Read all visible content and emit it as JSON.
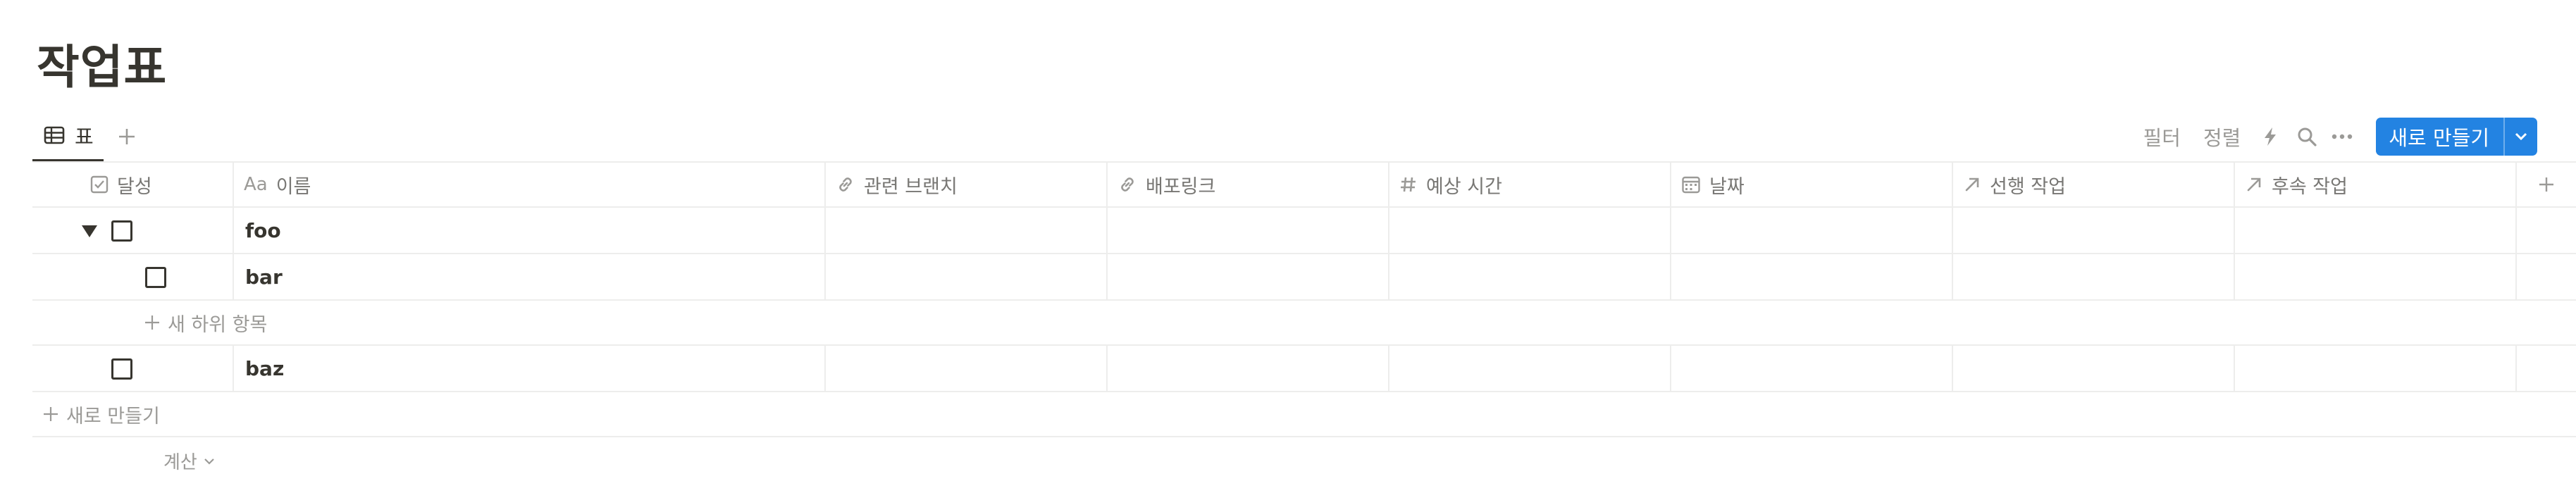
{
  "page": {
    "title": "작업표"
  },
  "view": {
    "tab_label": "표",
    "toolbar": {
      "filter_label": "필터",
      "sort_label": "정렬",
      "new_button_label": "새로 만들기"
    }
  },
  "table": {
    "columns": [
      {
        "label": "달성",
        "icon": "checkbox-icon"
      },
      {
        "label": "이름",
        "icon": "text-aa-icon",
        "icon_text": "Aa"
      },
      {
        "label": "관련 브랜치",
        "icon": "link-icon"
      },
      {
        "label": "배포링크",
        "icon": "link-icon"
      },
      {
        "label": "예상 시간",
        "icon": "hash-icon"
      },
      {
        "label": "날짜",
        "icon": "calendar-icon"
      },
      {
        "label": "선행 작업",
        "icon": "relation-arrow-icon"
      },
      {
        "label": "후속 작업",
        "icon": "relation-arrow-icon"
      }
    ],
    "rows": [
      {
        "name": "foo",
        "done": false,
        "expanded": true
      },
      {
        "name": "bar",
        "done": false,
        "subitem": true
      },
      {
        "name": "baz",
        "done": false
      }
    ],
    "new_subitem_label": "새 하위 항목",
    "new_row_label": "새로 만들기",
    "calculate_label": "계산"
  }
}
